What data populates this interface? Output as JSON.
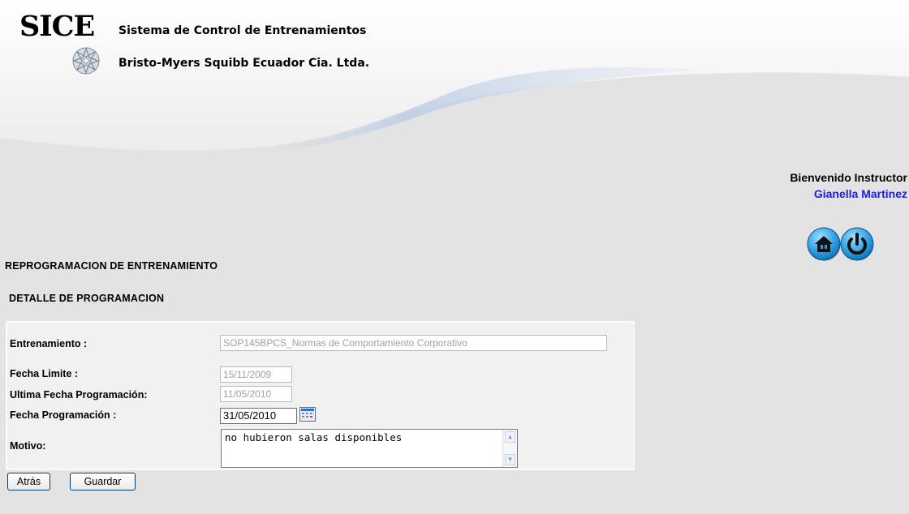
{
  "header": {
    "logo_text": "SICE",
    "system_title": "Sistema de Control de Entrenamientos",
    "company_name": "Bristo-Myers Squibb Ecuador Cia. Ltda."
  },
  "user": {
    "welcome_text": "Bienvenido Instructor",
    "user_name": "Gianella Martinez"
  },
  "nav_icons": {
    "home_icon": "home-icon",
    "logout_icon": "power-icon"
  },
  "page": {
    "title": "REPROGRAMACION DE ENTRENAMIENTO",
    "section_title": "DETALLE DE PROGRAMACION"
  },
  "form": {
    "training_label": "Entrenamiento :",
    "training_value": "SOP145BPCS_Normas de Comportamiento Corporativo",
    "deadline_label": "Fecha Limite :",
    "deadline_value": "15/11/2009",
    "last_date_label": "Ultima Fecha Programación:",
    "last_date_value": "11/05/2010",
    "schedule_date_label": "Fecha Programación :",
    "schedule_date_value": "31/05/2010",
    "reason_label": "Motivo:",
    "reason_value": "no hubieron salas disponibles"
  },
  "buttons": {
    "back_label": "Atrás",
    "save_label": "Guardar"
  },
  "colors": {
    "user_name": "#1a1aee",
    "icon_blue": "#1e90d8"
  }
}
